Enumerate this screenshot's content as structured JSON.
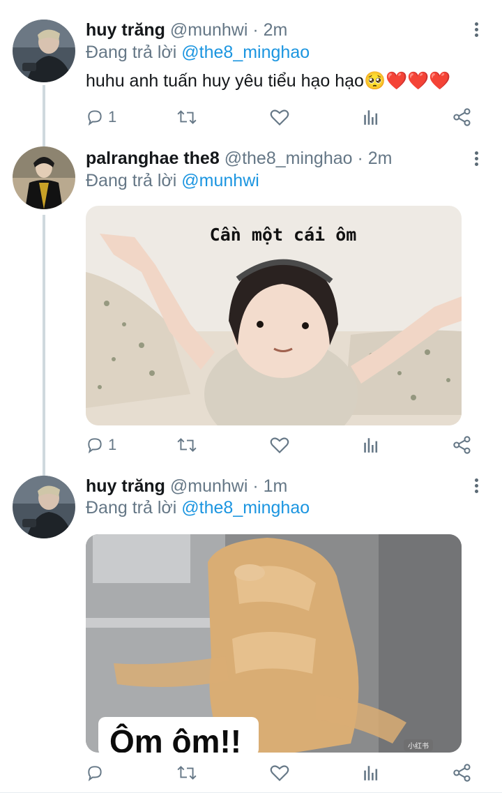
{
  "tweets": [
    {
      "name": "huy trăng",
      "handle": "@munhwi",
      "separator": "·",
      "time": "2m",
      "reply_prefix": "Đang trả lời",
      "reply_to": "@the8_minghao",
      "text": "huhu anh tuấn huy yêu tiểu hạo hạo",
      "emoji": "🥺❤️❤️❤️",
      "reply_count": "1"
    },
    {
      "name": "palranghae the8",
      "handle": "@the8_minghao",
      "separator": "·",
      "time": "2m",
      "reply_prefix": "Đang trả lời",
      "reply_to": "@munhwi",
      "image_caption": "Cần một cái ôm",
      "reply_count": "1"
    },
    {
      "name": "huy trăng",
      "handle": "@munhwi",
      "separator": "·",
      "time": "1m",
      "reply_prefix": "Đang trả lời",
      "reply_to": "@the8_minghao",
      "image_caption": "Ôm ôm!!",
      "watermark": "小红书",
      "reply_count": ""
    }
  ],
  "icons": {
    "reply": "reply-icon",
    "retweet": "retweet-icon",
    "like": "heart-icon",
    "stats": "analytics-icon",
    "share": "share-icon",
    "more": "more-vertical-icon"
  },
  "colors": {
    "link": "#1b95e0",
    "muted": "#657786",
    "thread": "#cfd9de",
    "heart": "#e0245e"
  }
}
